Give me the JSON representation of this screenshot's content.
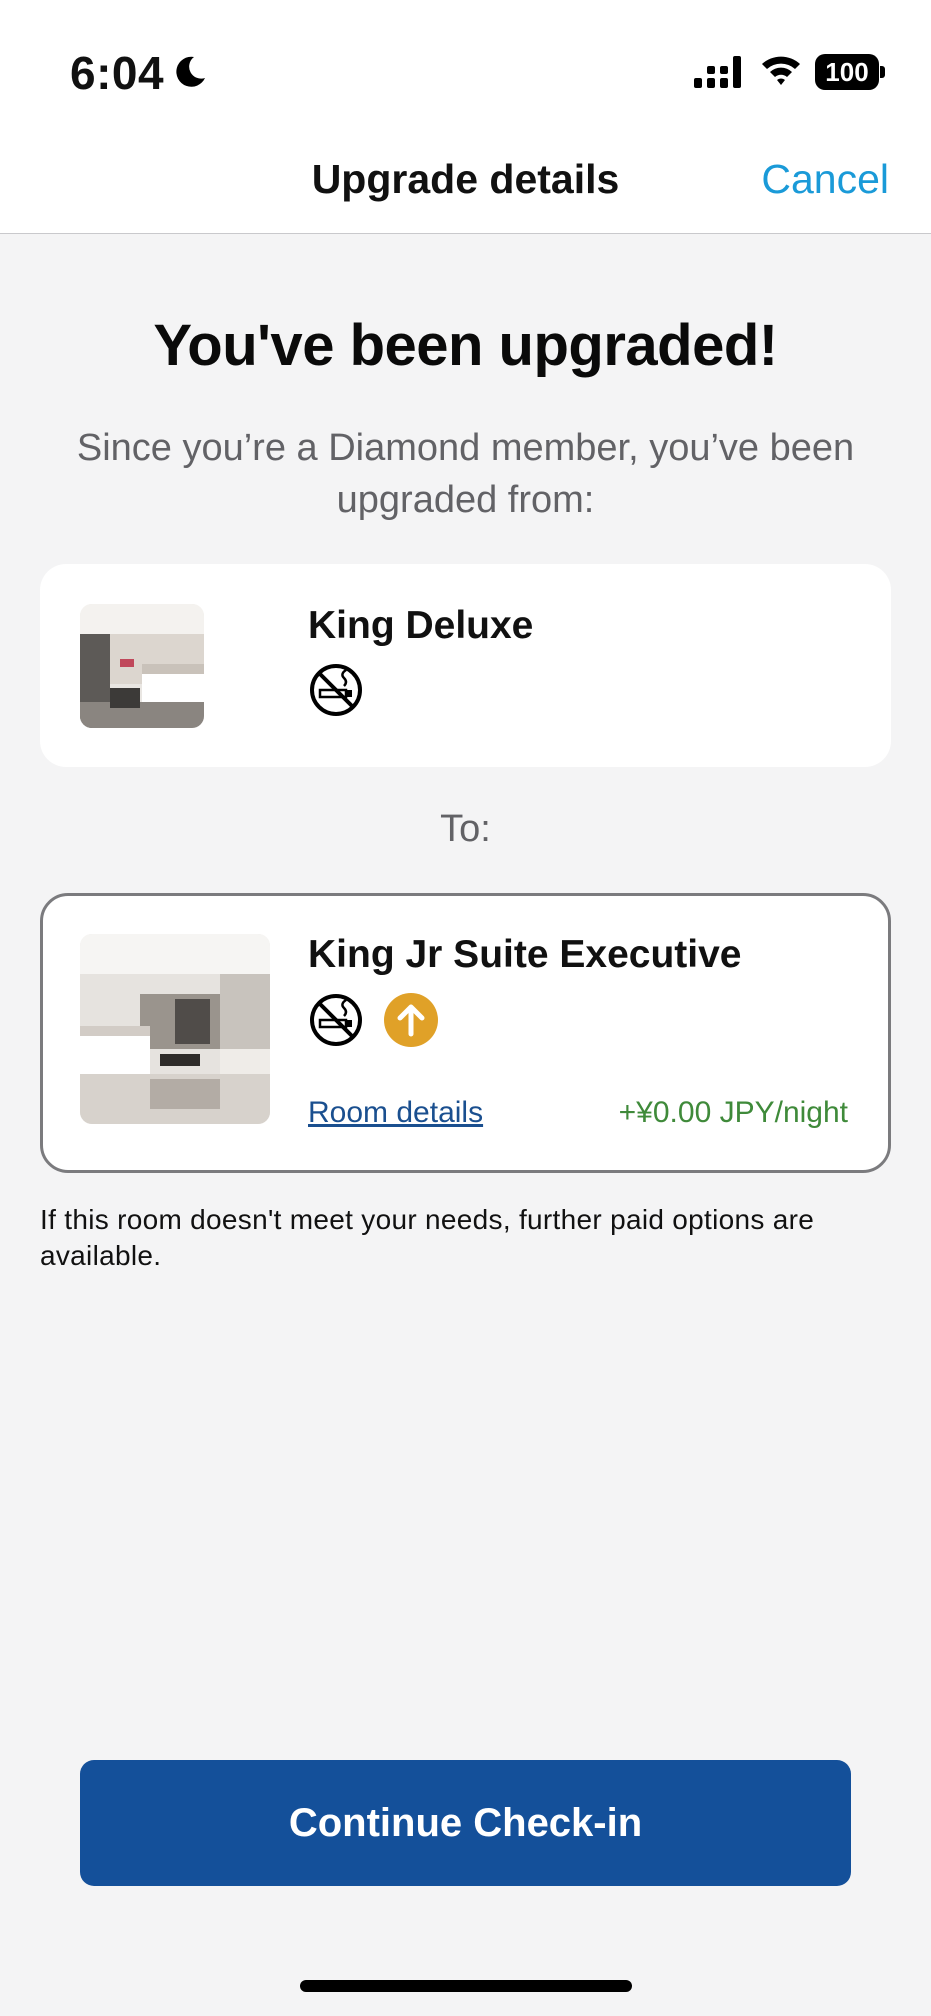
{
  "status_bar": {
    "time": "6:04",
    "battery": "100",
    "icons": [
      "moon-icon",
      "cellular-signal-icon",
      "wifi-icon",
      "battery-icon"
    ]
  },
  "header": {
    "title": "Upgrade details",
    "cancel_label": "Cancel"
  },
  "main": {
    "headline": "You've been upgraded!",
    "subtitle": "Since you’re a Diamond member, you’ve been upgraded from:",
    "from_room": {
      "name": "King Deluxe",
      "icons": [
        "no-smoking-icon"
      ]
    },
    "to_label": "To:",
    "to_room": {
      "name": "King Jr Suite Executive",
      "icons": [
        "no-smoking-icon",
        "upgrade-arrow-icon"
      ],
      "details_link": "Room details",
      "price": "+¥0.00 JPY/night"
    },
    "note": "If this room doesn't meet your needs, further paid options are available.",
    "continue_label": "Continue Check-in"
  },
  "colors": {
    "accent_link": "#1a9ad8",
    "primary_button": "#14509a",
    "price_green": "#3f8a3a",
    "upgrade_badge": "#e0a128"
  }
}
